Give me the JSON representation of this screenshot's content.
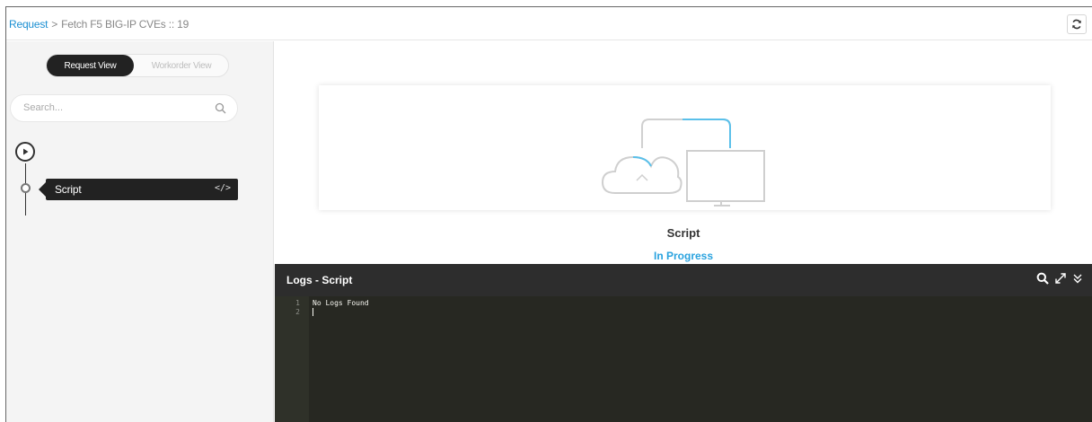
{
  "breadcrumb": {
    "root": "Request",
    "separator": ">",
    "current": "Fetch F5 BIG-IP CVEs :: 19"
  },
  "header": {
    "refresh_icon": "refresh-icon"
  },
  "sidebar": {
    "view_toggle": {
      "active": "Request View",
      "inactive": "Workorder View"
    },
    "search": {
      "placeholder": "Search..."
    },
    "steps": [
      {
        "label": "Script",
        "icon": "code-icon"
      }
    ]
  },
  "main": {
    "step_title": "Script",
    "step_status": "In Progress"
  },
  "logs": {
    "title": "Logs - Script",
    "lines": [
      {
        "number": "1",
        "text": "No Logs Found"
      },
      {
        "number": "2",
        "text": ""
      }
    ]
  },
  "colors": {
    "accent": "#1b8fd2",
    "status": "#2aa3df",
    "logs_background": "#272822"
  }
}
